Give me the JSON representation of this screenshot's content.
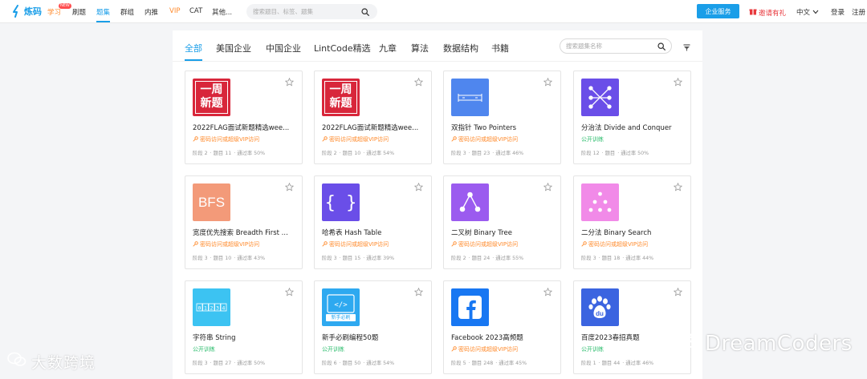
{
  "topnav": {
    "logo_text": "炼码",
    "items": [
      "学习",
      "刷题",
      "题集",
      "群组",
      "内推",
      "VIP",
      "CAT",
      "其他..."
    ],
    "new_badge": "NEW",
    "search_placeholder": "搜索题目、标签、题集",
    "enterprise_btn": "企业服务",
    "invite": "邀请有礼",
    "lang": "中文",
    "login": "登录",
    "register": "注册"
  },
  "categories": [
    "全部",
    "美国企业",
    "中国企业",
    "LintCode精选",
    "九章",
    "算法",
    "数据结构",
    "书籍"
  ],
  "set_search_placeholder": "搜索题集名称",
  "cards": [
    {
      "title": "2022FLAG面试新题精选wee...",
      "access": "密码访问或超级VIP访问",
      "stage": "阶段 2",
      "count": "题目 11",
      "rate": "通过率 50%"
    },
    {
      "title": "2022FLAG面试新题精选wee...",
      "access": "密码访问或超级VIP访问",
      "stage": "阶段 2",
      "count": "题目 10",
      "rate": "通过率 54%"
    },
    {
      "title": "双指针 Two Pointers",
      "access": "密码访问或超级VIP访问",
      "stage": "阶段 3",
      "count": "题目 23",
      "rate": "通过率 46%"
    },
    {
      "title": "分治法 Divide and Conquer",
      "access": "公开训练",
      "stage": "阶段 12",
      "count": "题目 ",
      "rate": "通过率 50%"
    },
    {
      "title": "宽度优先搜索 Breadth First ...",
      "access": "密码访问或超级VIP访问",
      "stage": "阶段 3",
      "count": "题目 10",
      "rate": "通过率 43%"
    },
    {
      "title": "哈希表 Hash Table",
      "access": "密码访问或超级VIP访问",
      "stage": "阶段 3",
      "count": "题目 15",
      "rate": "通过率 39%"
    },
    {
      "title": "二叉树 Binary Tree",
      "access": "密码访问或超级VIP访问",
      "stage": "阶段 2",
      "count": "题目 24",
      "rate": "通过率 55%"
    },
    {
      "title": "二分法 Binary Search",
      "access": "密码访问或超级VIP访问",
      "stage": "阶段 3",
      "count": "题目 18",
      "rate": "通过率 44%"
    },
    {
      "title": "字符串 String",
      "access": "公开训练",
      "stage": "阶段 3",
      "count": "题目 27",
      "rate": "通过率 50%"
    },
    {
      "title": "新手必刷编程50题",
      "access": "公开训练",
      "stage": "阶段 6",
      "count": "题目 50",
      "rate": "通过率 54%"
    },
    {
      "title": "Facebook 2023高频题",
      "access": "密码访问或超级VIP访问",
      "stage": "阶段 5",
      "count": "题目 248",
      "rate": "通过率 45%"
    },
    {
      "title": "百度2023春招真题",
      "access": "公开训练",
      "stage": "阶段 1",
      "count": "题目 44",
      "rate": "通过率 46%"
    }
  ],
  "thumbs": {
    "weekly": "一周新题",
    "bfs": "BFS",
    "string_cells": [
      "0",
      "1",
      "2",
      "3",
      "4"
    ],
    "newbie": "新手必刷"
  },
  "colors": {
    "accent": "#1a9ee8",
    "vip": "#ff8a2b",
    "public": "#2dbd6e"
  },
  "watermarks": {
    "left": "大数跨境",
    "right": "DreamCoders"
  }
}
